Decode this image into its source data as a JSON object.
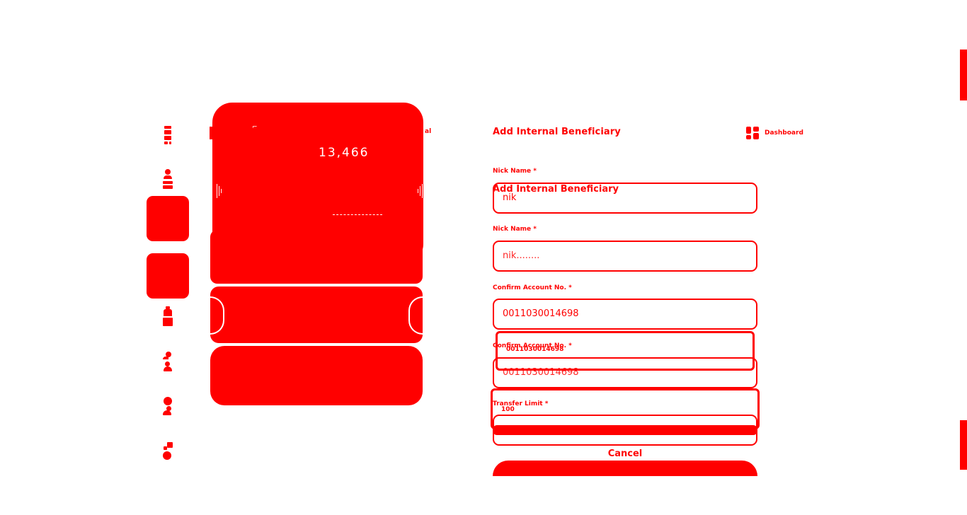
{
  "form": {
    "title": "Add Internal Beneficiary",
    "ghost_title": "Add Internal Beneficiary",
    "dashboard_label": "Dashboard",
    "fields": [
      {
        "label": "Nick Name *",
        "value": "nik"
      },
      {
        "label": "Nick Name *",
        "value": "nik........"
      },
      {
        "label": "Confirm Account No. *",
        "value": "0011030014698"
      },
      {
        "label": "Confirm Account No. *",
        "value": "0011030014698"
      },
      {
        "label": "Transfer Limit *",
        "value": "100"
      }
    ],
    "cancel_label": "Cancel"
  },
  "card": {
    "amount": "13,466",
    "side_label": "al"
  },
  "colors": {
    "accent": "#ff0000",
    "background": "#ffffff"
  },
  "icons": {
    "rail": [
      "document-icon",
      "user-list-icon",
      "wallet-icon",
      "users-icon",
      "user-settings-icon",
      "transfer-icon"
    ],
    "dashboard": "dashboard-grid-icon"
  }
}
